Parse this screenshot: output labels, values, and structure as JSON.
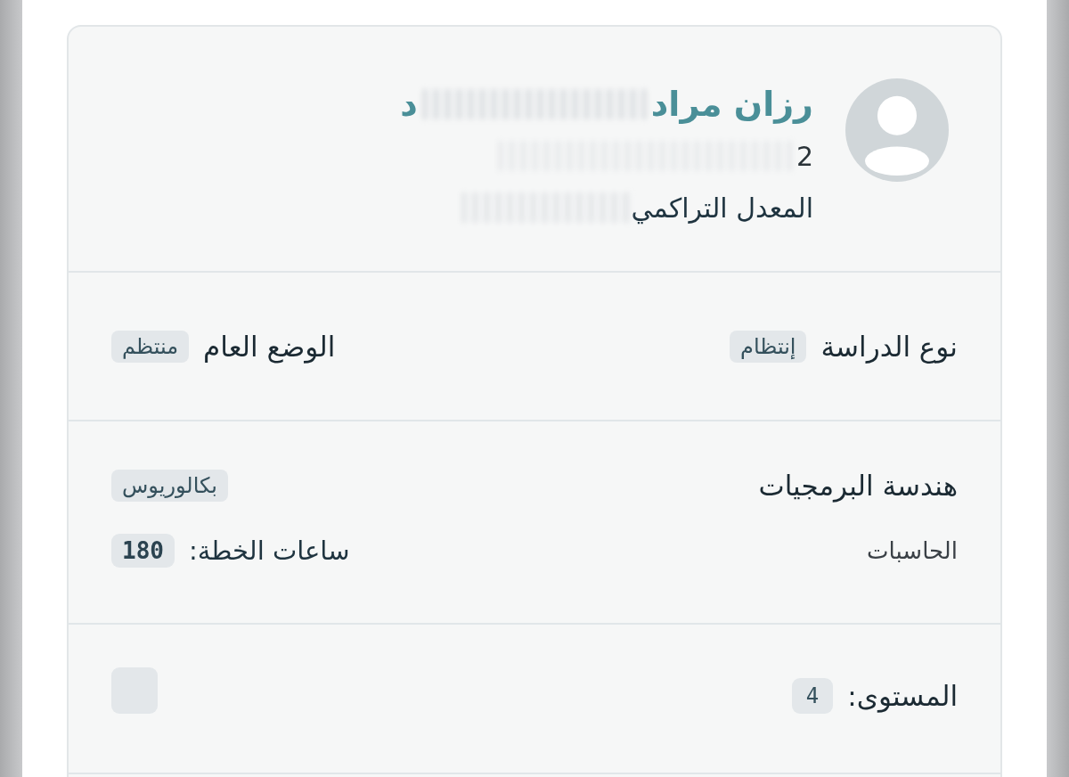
{
  "profile": {
    "name": "رزان مراد",
    "name_tail": "د",
    "line_2": "2",
    "gpa_label": "المعدل التراكمي"
  },
  "study_info": [
    {
      "label": "نوع الدراسة",
      "value": "إنتظام"
    },
    {
      "label": "الوضع العام",
      "value": "منتظم"
    }
  ],
  "program": {
    "major": "هندسة البرمجيات",
    "college": "الحاسبات",
    "degree": "بكالوريوس",
    "hours_label": "ساعات الخطة:",
    "hours": "180"
  },
  "level": {
    "label": "المستوى:",
    "value": "4"
  }
}
